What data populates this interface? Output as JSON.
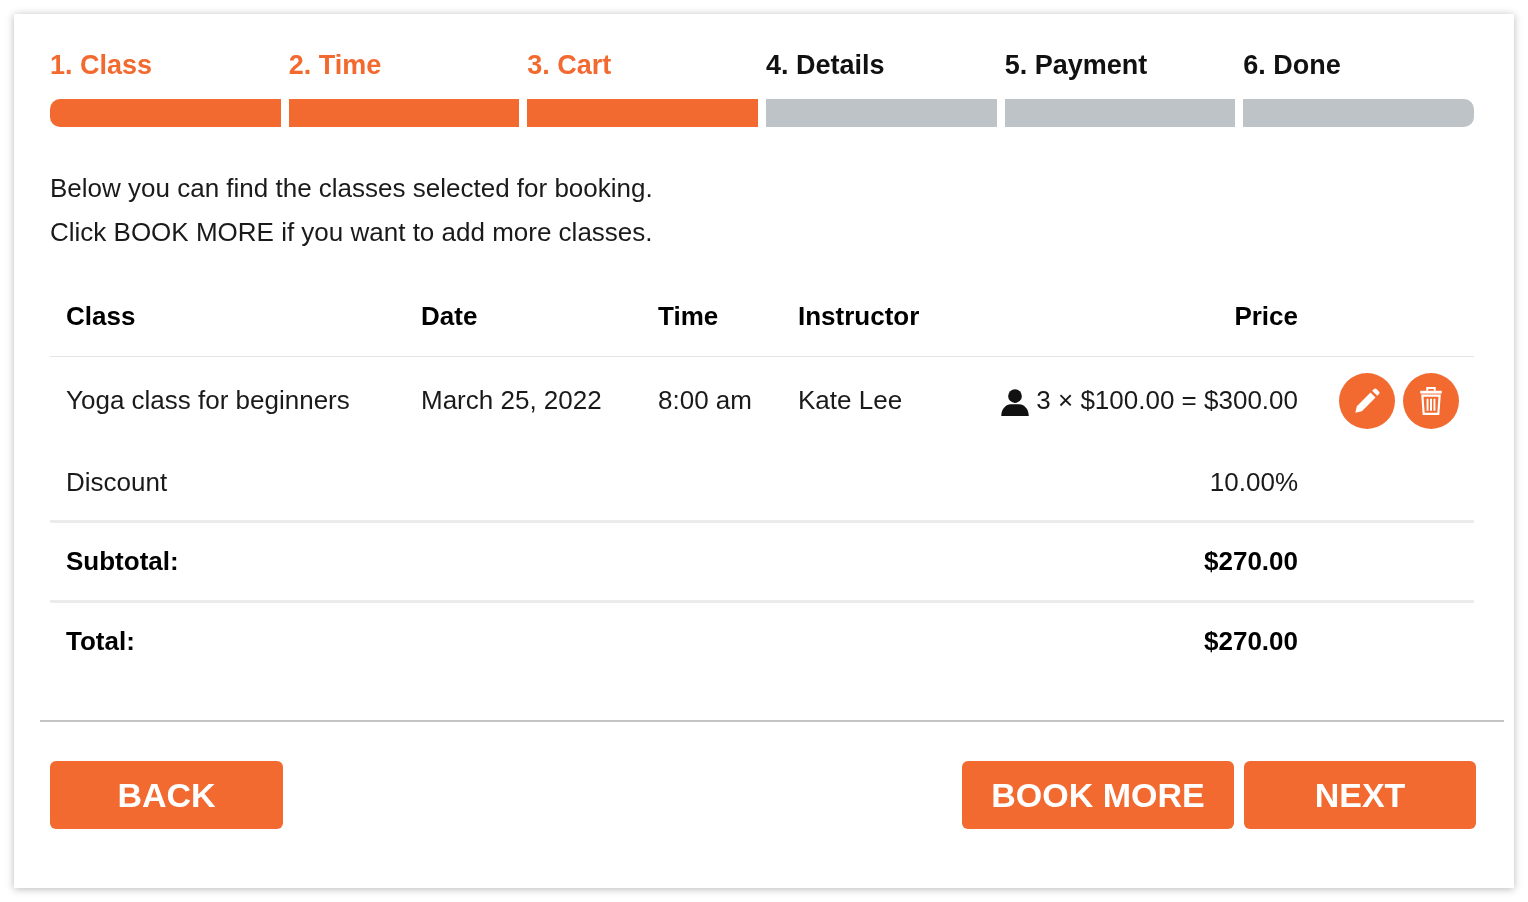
{
  "steps": [
    {
      "label": "1. Class",
      "completed": true
    },
    {
      "label": "2. Time",
      "completed": true
    },
    {
      "label": "3. Cart",
      "completed": true
    },
    {
      "label": "4. Details",
      "completed": false
    },
    {
      "label": "5. Payment",
      "completed": false
    },
    {
      "label": "6. Done",
      "completed": false
    }
  ],
  "intro": [
    "Below you can find the classes selected for booking.",
    "Click BOOK MORE if you want to add more classes."
  ],
  "table": {
    "columns": [
      "Class",
      "Date",
      "Time",
      "Instructor",
      "Price"
    ],
    "rows": [
      {
        "class": "Yoga class for beginners",
        "date": "March 25, 2022",
        "time": "8:00 am",
        "instructor": "Kate Lee",
        "price": "3 × $100.00 = $300.00"
      }
    ],
    "summary": [
      {
        "kind": "discount",
        "label": "Discount",
        "value": "10.00%"
      },
      {
        "kind": "subtotal",
        "label": "Subtotal:",
        "value": "$270.00"
      },
      {
        "kind": "total",
        "label": "Total:",
        "value": "$270.00"
      }
    ]
  },
  "buttons": {
    "back": "BACK",
    "book_more": "BOOK MORE",
    "next": "NEXT"
  }
}
